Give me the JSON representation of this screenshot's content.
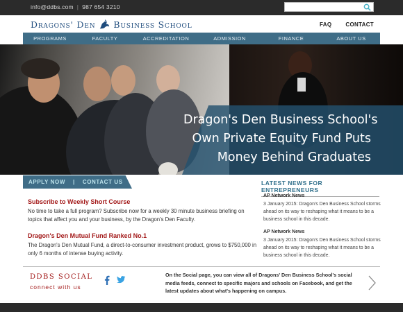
{
  "topbar": {
    "email": "info@ddbs.com",
    "phone": "987 654 3210",
    "separator": "|"
  },
  "header": {
    "logo_part1": "Dragons' Den",
    "logo_part2": "Business School",
    "links": [
      "FAQ",
      "CONTACT"
    ]
  },
  "nav": {
    "items": [
      "PROGRAMS",
      "FACULTY",
      "ACCREDITATION",
      "ADMISSION",
      "FINANCE",
      "ABOUT US"
    ]
  },
  "hero": {
    "caption_lines": [
      "Dragon's Den Business School's",
      "Own Private Equity Fund Puts",
      "Money Behind Graduates"
    ]
  },
  "cta": {
    "apply": "APPLY NOW",
    "separator": "|",
    "contact": "CONTACT US"
  },
  "promos": [
    {
      "title": "Subscribe to Weekly Short Course",
      "body": "No time to take a full program?  Subscribe now for a weekly 30 minute business briefing on topics that affect you and your business, by the Dragon's Den Faculty."
    },
    {
      "title": "Dragon's Den Mutual Fund Ranked No.1",
      "body": "The Dragon's Den Mutual Fund, a direct-to-consumer investment product, grows to $750,000 in only 6 months of intense buying activity."
    }
  ],
  "news": {
    "title": "LATEST NEWS FOR ENTREPRENEURS",
    "items": [
      {
        "source": "AP Network News",
        "text": "3 January 2015: Dragon's Den Business School storms ahead on its way to reshaping what it means to be a business school in this decade."
      },
      {
        "source": "AP Network News",
        "text": "3 January 2015: Dragon's Den Business School storms ahead on its way to reshaping what it means to be a business school in this decade."
      }
    ]
  },
  "social": {
    "title": "DDBS SOCIAL",
    "subtitle": "connect with us",
    "description": "On the Social page, you can view all of Dragons' Den Business School's social media feeds, connect to specific majors and schools on Facebook, and get the latest updates about what's happening on campus."
  },
  "colors": {
    "accent": "#3f6d87",
    "brand": "#1f4c7d",
    "headline_red": "#a31a1a"
  },
  "icons": [
    "search-icon",
    "dragon-logo-icon",
    "facebook-icon",
    "twitter-icon",
    "chevron-right-icon"
  ]
}
